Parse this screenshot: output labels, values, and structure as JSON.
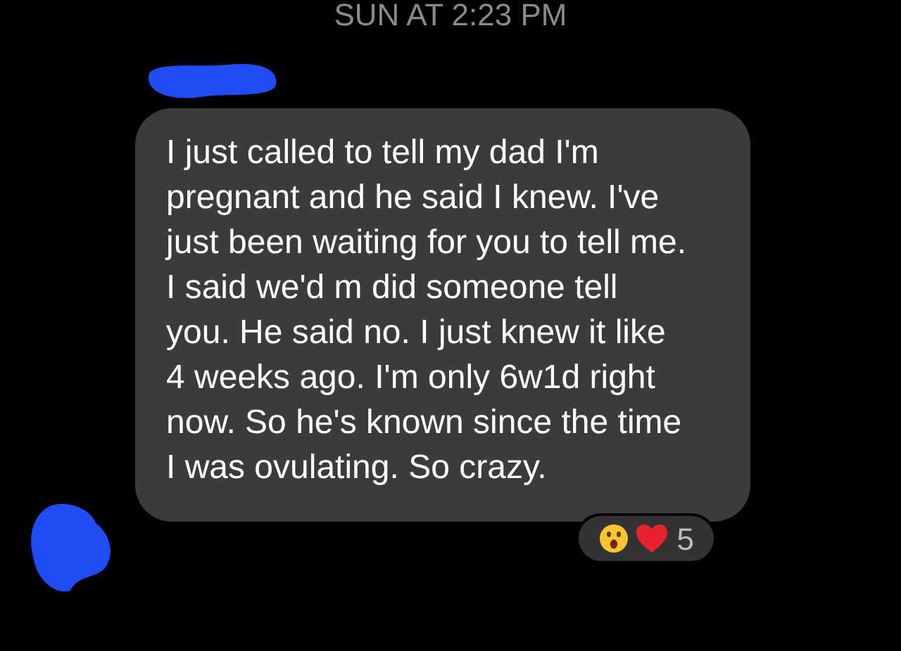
{
  "timestamp": "SUN AT 2:23 PM",
  "message": {
    "text": "I just called to tell my dad I'm pregnant and he said I knew. I've just been waiting for you to tell me. I said we'd m did someone tell you. He said no. I just knew it like 4 weeks ago. I'm only 6w1d right now. So he's known since the time I was ovulating. So crazy.",
    "reactions": {
      "count": "5"
    }
  }
}
